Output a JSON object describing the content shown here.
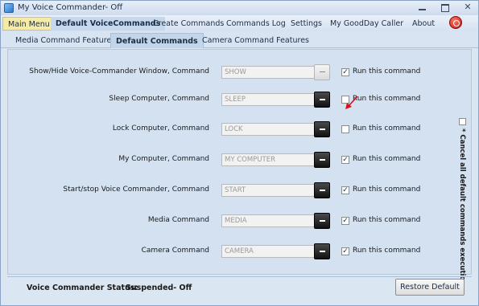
{
  "window": {
    "title": "My Voice Commander- Off"
  },
  "menu": {
    "items": [
      {
        "label": "Main Menu"
      },
      {
        "label": "Default VoiceCommands"
      },
      {
        "label": "Create Commands"
      },
      {
        "label": "Commands Log"
      },
      {
        "label": "Settings"
      },
      {
        "label": "My GoodDay Caller"
      },
      {
        "label": "About"
      }
    ]
  },
  "tabs": [
    {
      "label": "Media Command Features"
    },
    {
      "label": "Default Commands"
    },
    {
      "label": "Camera Command Features"
    }
  ],
  "commands": [
    {
      "label": "Show/Hide Voice-Commander Window, Command",
      "value": "SHOW",
      "checked": true,
      "checkbox_label": "Run this command"
    },
    {
      "label": "Sleep Computer, Command",
      "value": "SLEEP",
      "checked": false,
      "checkbox_label": "Run this command"
    },
    {
      "label": "Lock Computer, Command",
      "value": "LOCK",
      "checked": false,
      "checkbox_label": "Run this command"
    },
    {
      "label": "My Computer, Command",
      "value": "MY COMPUTER",
      "checked": true,
      "checkbox_label": "Run this command"
    },
    {
      "label": "Start/stop Voice Commander, Command",
      "value": "START",
      "checked": true,
      "checkbox_label": "Run this command"
    },
    {
      "label": "Media Command",
      "value": "MEDIA",
      "checked": true,
      "checkbox_label": "Run this command"
    },
    {
      "label": "Camera Command",
      "value": "CAMERA",
      "checked": true,
      "checkbox_label": "Run this command"
    }
  ],
  "cancel_all": {
    "label": "* Cancel all default commands execution",
    "checked": false
  },
  "status": {
    "label": "Voice Commander Status:",
    "value": "Suspended- Off"
  },
  "restore_button": {
    "label": "Restore Default"
  },
  "colors": {
    "menu_highlight": "#f5eaa6",
    "arrow": "#d8141a"
  }
}
